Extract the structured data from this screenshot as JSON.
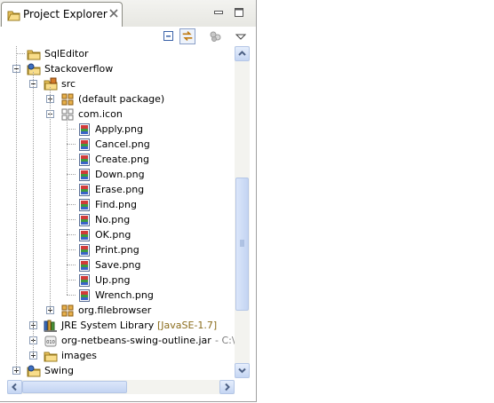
{
  "view": {
    "tab_title": "Project Explorer"
  },
  "tree": [
    {
      "label": "SqlEditor",
      "icon": "folder-icon",
      "expander": "none"
    },
    {
      "label": "Stackoverflow",
      "icon": "java-project-icon",
      "expander": "minus"
    },
    {
      "label": "src",
      "icon": "source-folder-icon",
      "expander": "minus"
    },
    {
      "label": "(default package)",
      "icon": "package-icon",
      "expander": "plus"
    },
    {
      "label": "com.icon",
      "icon": "package-open-icon",
      "expander": "minus"
    },
    {
      "label": "Apply.png",
      "icon": "image-file-icon",
      "expander": "none"
    },
    {
      "label": "Cancel.png",
      "icon": "image-file-icon",
      "expander": "none"
    },
    {
      "label": "Create.png",
      "icon": "image-file-icon",
      "expander": "none"
    },
    {
      "label": "Down.png",
      "icon": "image-file-icon",
      "expander": "none"
    },
    {
      "label": "Erase.png",
      "icon": "image-file-icon",
      "expander": "none"
    },
    {
      "label": "Find.png",
      "icon": "image-file-icon",
      "expander": "none"
    },
    {
      "label": "No.png",
      "icon": "image-file-icon",
      "expander": "none"
    },
    {
      "label": "OK.png",
      "icon": "image-file-icon",
      "expander": "none"
    },
    {
      "label": "Print.png",
      "icon": "image-file-icon",
      "expander": "none"
    },
    {
      "label": "Save.png",
      "icon": "image-file-icon",
      "expander": "none"
    },
    {
      "label": "Up.png",
      "icon": "image-file-icon",
      "expander": "none"
    },
    {
      "label": "Wrench.png",
      "icon": "image-file-icon",
      "expander": "none"
    },
    {
      "label": "org.filebrowser",
      "icon": "package-icon",
      "expander": "plus"
    },
    {
      "label": "JRE System Library",
      "decoration": "[JavaSE-1.7]",
      "icon": "library-icon",
      "expander": "plus"
    },
    {
      "label": "org-netbeans-swing-outline.jar",
      "decoration": "- C:\\Doc",
      "icon": "jar-icon",
      "expander": "plus"
    },
    {
      "label": "images",
      "icon": "folder-icon",
      "expander": "plus"
    },
    {
      "label": "Swing",
      "icon": "java-project-icon",
      "expander": "plus"
    }
  ],
  "colors": {
    "accent": "#316ac5",
    "decoration": "#8b6d1d",
    "scroll": "#c5d6f3"
  }
}
